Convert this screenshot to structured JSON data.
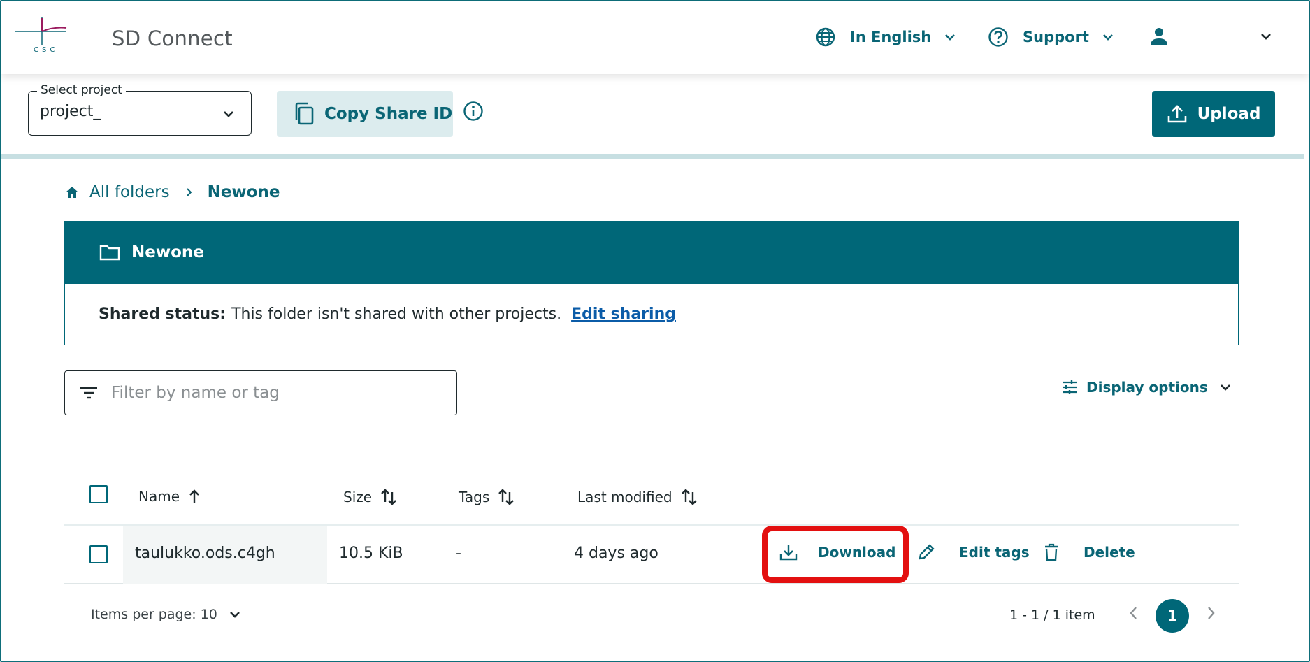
{
  "header": {
    "logo_text": "CSC",
    "app_title": "SD Connect",
    "language_label": "In English",
    "support_label": "Support"
  },
  "toolbar": {
    "select_project_label": "Select project",
    "select_project_value": "project_",
    "copy_share_id_label": "Copy Share ID",
    "upload_label": "Upload"
  },
  "breadcrumb": {
    "root_label": "All folders",
    "current_label": "Newone"
  },
  "folder": {
    "name": "Newone",
    "shared_status_label": "Shared status:",
    "shared_status_text": "This folder isn't shared with other projects.",
    "edit_sharing_label": "Edit sharing"
  },
  "filter": {
    "placeholder": "Filter by name or tag",
    "value": ""
  },
  "display_options_label": "Display options",
  "table": {
    "columns": [
      "Name",
      "Size",
      "Tags",
      "Last modified"
    ],
    "rows": [
      {
        "name": "taulukko.ods.c4gh",
        "size": "10.5 KiB",
        "tags": "-",
        "last_modified": "4 days ago",
        "actions": {
          "download": "Download",
          "edit_tags": "Edit tags",
          "delete": "Delete"
        }
      }
    ]
  },
  "pagination": {
    "items_per_page_label": "Items per page: 10",
    "range_label": "1 - 1 / 1 item",
    "current_page": "1"
  },
  "colors": {
    "primary_teal": "#006778",
    "highlight_red": "#e31010",
    "button_muted": "#dcecee"
  }
}
